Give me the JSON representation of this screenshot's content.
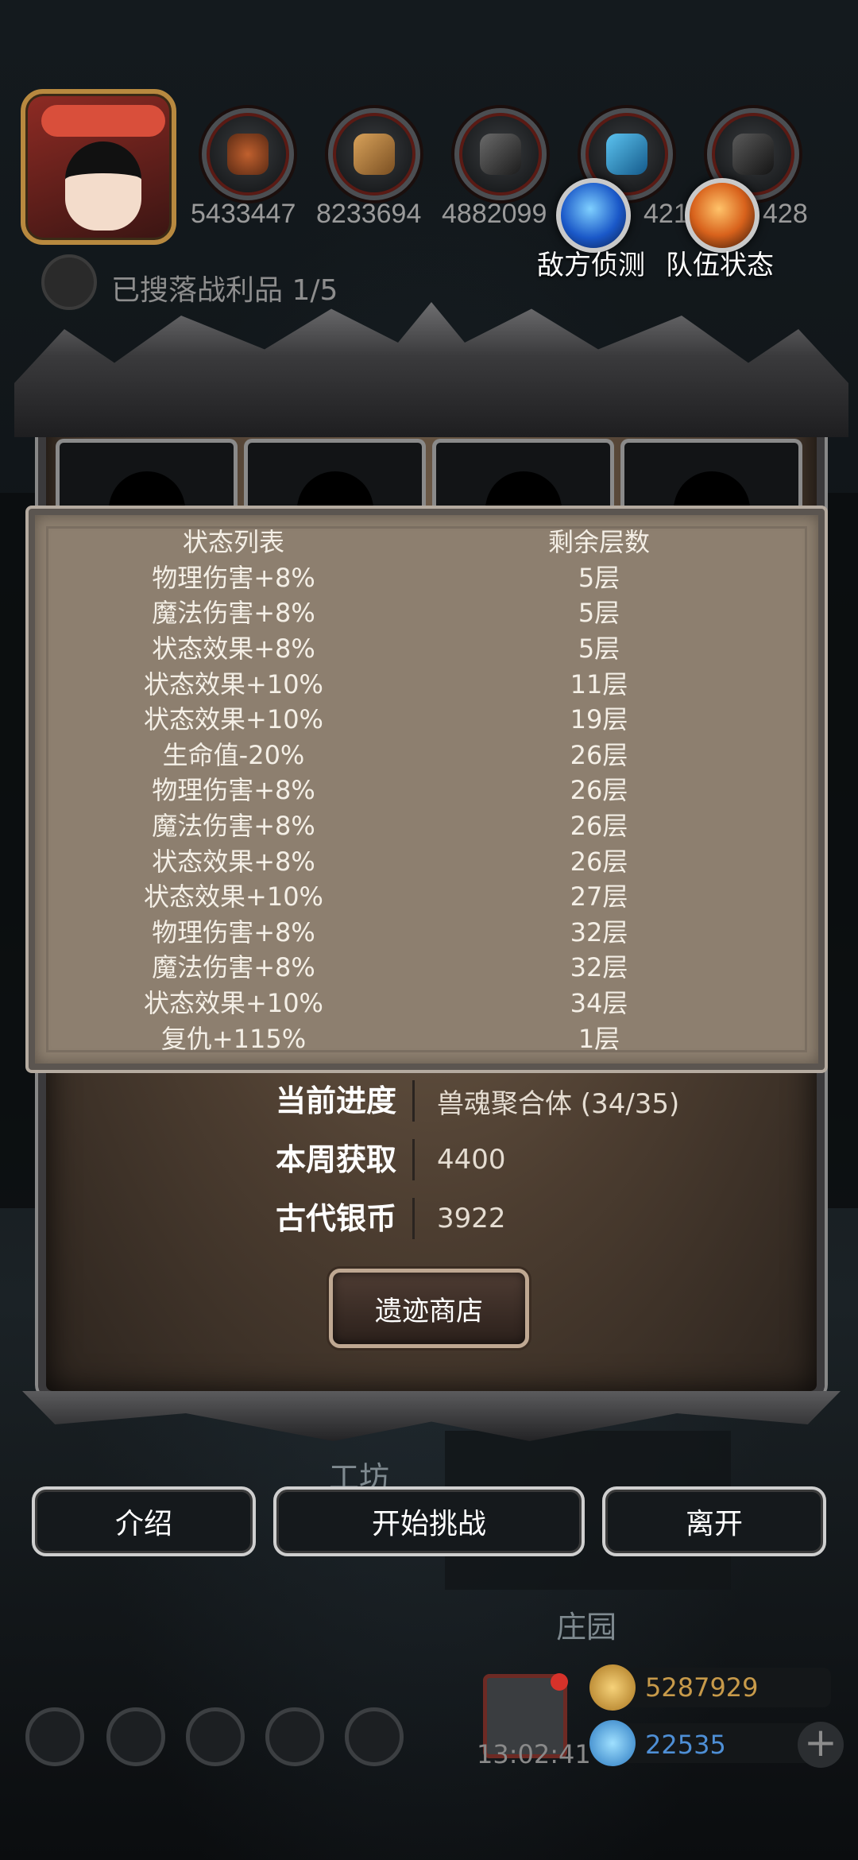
{
  "resources": {
    "values": [
      "5433447",
      "8233694",
      "4882099",
      "421",
      "428"
    ],
    "icons": [
      "meat-icon",
      "wood-icon",
      "iron-icon",
      "crystal-icon",
      "stone-icon"
    ]
  },
  "buttons_top": {
    "enemy_scout": "敌方侦测",
    "team_status": "队伍状态"
  },
  "scroll_text": "已搜落战利品 1/5",
  "status_table": {
    "header_name": "状态列表",
    "header_layers": "剩余层数",
    "rows": [
      {
        "name": "物理伤害+8%",
        "layers": "5层"
      },
      {
        "name": "魔法伤害+8%",
        "layers": "5层"
      },
      {
        "name": "状态效果+8%",
        "layers": "5层"
      },
      {
        "name": "状态效果+10%",
        "layers": "11层"
      },
      {
        "name": "状态效果+10%",
        "layers": "19层"
      },
      {
        "name": "生命值-20%",
        "layers": "26层"
      },
      {
        "name": "物理伤害+8%",
        "layers": "26层"
      },
      {
        "name": "魔法伤害+8%",
        "layers": "26层"
      },
      {
        "name": "状态效果+8%",
        "layers": "26层"
      },
      {
        "name": "状态效果+10%",
        "layers": "27层"
      },
      {
        "name": "物理伤害+8%",
        "layers": "32层"
      },
      {
        "name": "魔法伤害+8%",
        "layers": "32层"
      },
      {
        "name": "状态效果+10%",
        "layers": "34层"
      },
      {
        "name": "复仇+115%",
        "layers": "1层"
      }
    ]
  },
  "info": {
    "progress_label": "当前进度",
    "progress_value": "兽魂聚合体 (34/35)",
    "weekly_label": "本周获取",
    "weekly_value": "4400",
    "silver_label": "古代银币",
    "silver_value": "3922"
  },
  "shop_button": "遗迹商店",
  "actions": {
    "intro": "介绍",
    "start": "开始挑战",
    "leave": "离开"
  },
  "background_labels": {
    "workshop": "工坊",
    "manor": "庄园"
  },
  "bottom": {
    "timer": "13:02:41",
    "gold": "5287929",
    "gems": "22535",
    "plus": "+"
  }
}
